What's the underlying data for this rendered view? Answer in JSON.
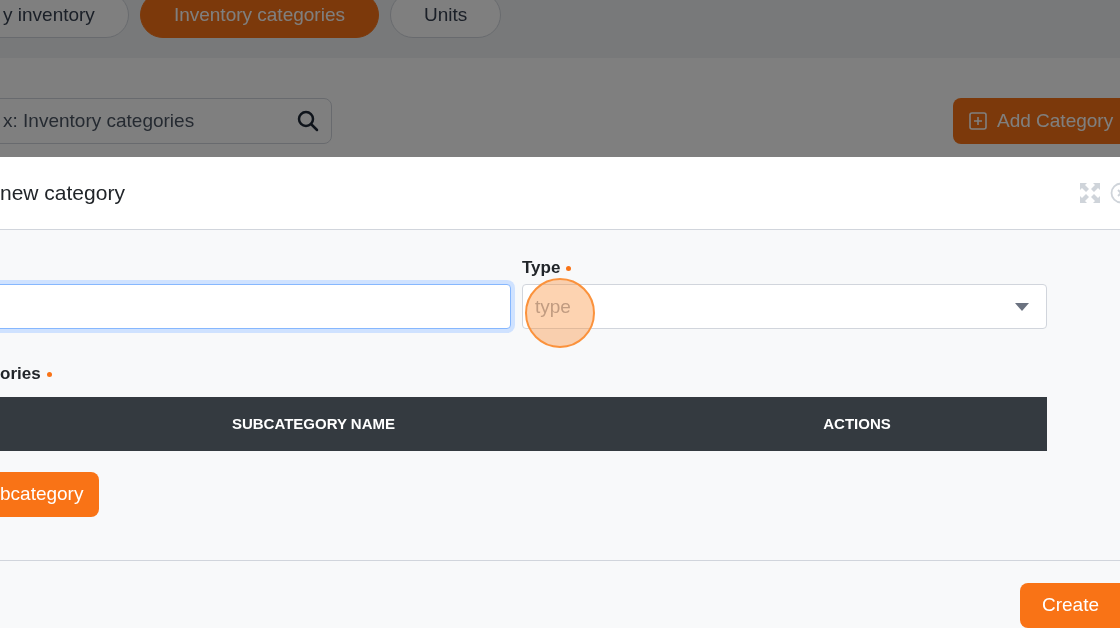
{
  "tabs": [
    {
      "label": "y inventory",
      "selected": false
    },
    {
      "label": "Inventory categories",
      "selected": true
    },
    {
      "label": "Units",
      "selected": false
    }
  ],
  "search": {
    "placeholder": "x: Inventory categories"
  },
  "add_button": {
    "label": "Add Category"
  },
  "modal": {
    "title": "new category",
    "fields": [
      {
        "kind": "text",
        "focused": true
      },
      {
        "kind": "select",
        "label": "Type",
        "required": true,
        "placeholder": "type",
        "focused": false
      }
    ],
    "subcategories": {
      "label": "ories",
      "required": true,
      "columns": [
        "SUBCATEGORY NAME",
        "ACTIONS"
      ]
    },
    "add_subcategory_button": "bcategory",
    "create_button": "Create"
  }
}
